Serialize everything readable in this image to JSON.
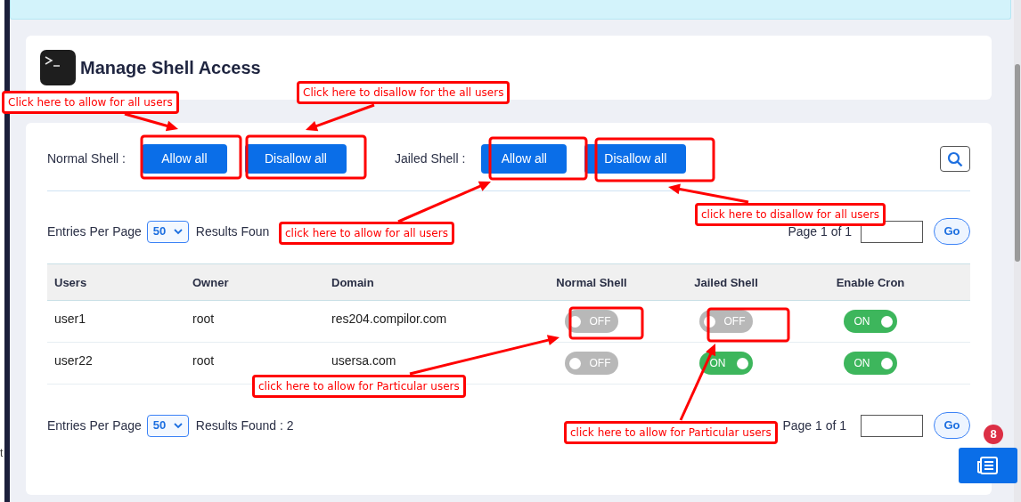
{
  "header": {
    "title": "Manage Shell Access"
  },
  "shell_actions": [
    {
      "label": "Normal Shell :",
      "buttons": [
        "Allow all",
        "Disallow all"
      ]
    },
    {
      "label": "Jailed Shell :",
      "buttons": [
        "Allow all",
        "Disallow all"
      ]
    }
  ],
  "top_pager": {
    "entries_label": "Entries Per Page",
    "per_page": "50",
    "results": "Results Foun",
    "page": "Page 1 of 1",
    "go": "Go"
  },
  "table": {
    "columns": [
      "Users",
      "Owner",
      "Domain",
      "Normal Shell",
      "Jailed Shell",
      "Enable Cron"
    ],
    "rows": [
      {
        "user": "user1",
        "owner": "root",
        "domain": "res204.compilor.com",
        "toggles": [
          {
            "on": false,
            "label": "OFF"
          },
          {
            "on": false,
            "label": "OFF"
          },
          {
            "on": true,
            "label": "ON"
          }
        ]
      },
      {
        "user": "user22",
        "owner": "root",
        "domain": "usersa.com",
        "toggles": [
          {
            "on": false,
            "label": "OFF"
          },
          {
            "on": true,
            "label": "ON"
          },
          {
            "on": true,
            "label": "ON"
          }
        ]
      }
    ]
  },
  "bottom_pager": {
    "entries_label": "Entries Per Page",
    "per_page": "50",
    "results": "Results Found : 2",
    "page": "Page 1 of 1",
    "go": "Go"
  },
  "notification_badge": "8",
  "edge_text": "t",
  "annotations": [
    "Click here to allow for all users",
    "Click here to disallow for the all users",
    "click here to allow for all users",
    "click here to disallow for all users",
    "click here to allow for Particular users",
    "click here to allow for Particular users"
  ]
}
